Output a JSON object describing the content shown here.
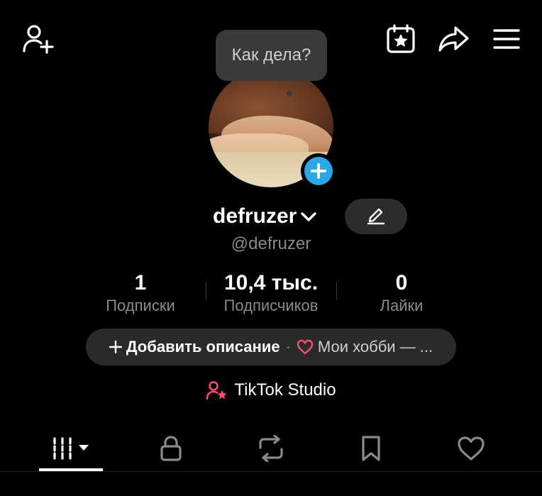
{
  "header": {
    "icons": [
      "add-user-icon",
      "calendar-star-icon",
      "share-icon",
      "menu-icon"
    ]
  },
  "bubble": {
    "text": "Как дела?"
  },
  "profile": {
    "username": "defruzer",
    "handle": "@defruzer"
  },
  "stats": [
    {
      "value": "1",
      "label": "Подписки"
    },
    {
      "value": "10,4 тыс.",
      "label": "Подписчиков"
    },
    {
      "value": "0",
      "label": "Лайки"
    }
  ],
  "bio": {
    "add_label": "Добавить описание",
    "separator": "·",
    "hobby_label": "Мои хобби — ..."
  },
  "studio": {
    "label": "TikTok Studio"
  },
  "tabs": [
    "videos",
    "private",
    "reposts",
    "saved",
    "liked"
  ],
  "colors": {
    "accent_blue": "#2aa7e6",
    "heart_red": "#ff4d6d",
    "studio_icon": "#ff4d6d"
  }
}
